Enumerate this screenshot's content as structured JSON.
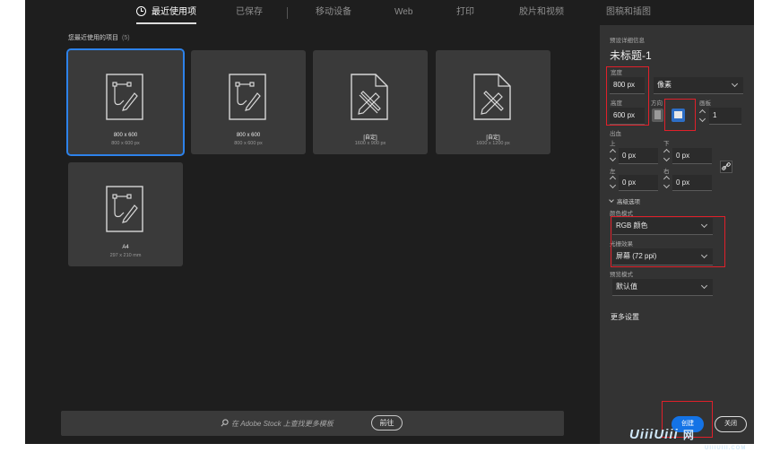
{
  "tabs": [
    {
      "label": "最近使用项",
      "active": true
    },
    {
      "label": "已保存"
    },
    {
      "label": "移动设备"
    },
    {
      "label": "Web"
    },
    {
      "label": "打印"
    },
    {
      "label": "胶片和视频"
    },
    {
      "label": "图稿和插图"
    }
  ],
  "recent": {
    "title": "您最近使用的项目",
    "count": "(5)",
    "items": [
      {
        "title": "800 x 600",
        "size": "800 x 600 px",
        "icon": "artboard-icon",
        "selected": true
      },
      {
        "title": "800 x 600",
        "size": "800 x 600 px",
        "icon": "artboard-icon"
      },
      {
        "title": "[自定]",
        "size": "1600 x 900 px",
        "icon": "document-pencil-icon"
      },
      {
        "title": "[自定]",
        "size": "1600 x 1200 px",
        "icon": "document-pencil-icon"
      },
      {
        "title": "A4",
        "size": "297 x 210 mm",
        "icon": "artboard-icon"
      }
    ]
  },
  "search": {
    "placeholder": "在 Adobe Stock 上查找更多模板",
    "go_label": "前往"
  },
  "panel": {
    "section_title": "预设详细信息",
    "doc_name": "未标题-1",
    "width_label": "宽度",
    "width_value": "800 px",
    "unit_value": "像素",
    "height_label": "高度",
    "height_value": "600 px",
    "orientation_label": "方向",
    "artboard_label": "画板",
    "artboard_value": "1",
    "bleed_label": "出血",
    "bleed_top_label": "上",
    "bleed_top_value": "0 px",
    "bleed_bottom_label": "下",
    "bleed_bottom_value": "0 px",
    "bleed_left_label": "左",
    "bleed_left_value": "0 px",
    "bleed_right_label": "右",
    "bleed_right_value": "0 px",
    "advanced_label": "高级选项",
    "color_mode_label": "颜色模式",
    "color_mode_value": "RGB 颜色",
    "raster_label": "光栅效果",
    "raster_value": "屏幕 (72 ppi)",
    "preview_label": "预览模式",
    "preview_value": "默认值",
    "more_settings": "更多设置",
    "create_label": "创建",
    "close_label": "关闭"
  },
  "watermark": {
    "text": "UiiiUiii",
    "sub": "UIIIUIII.COM",
    "corner": "网"
  },
  "colors": {
    "accent": "#1473e6",
    "selection": "#2d82ea",
    "annotation": "#e0202a"
  }
}
